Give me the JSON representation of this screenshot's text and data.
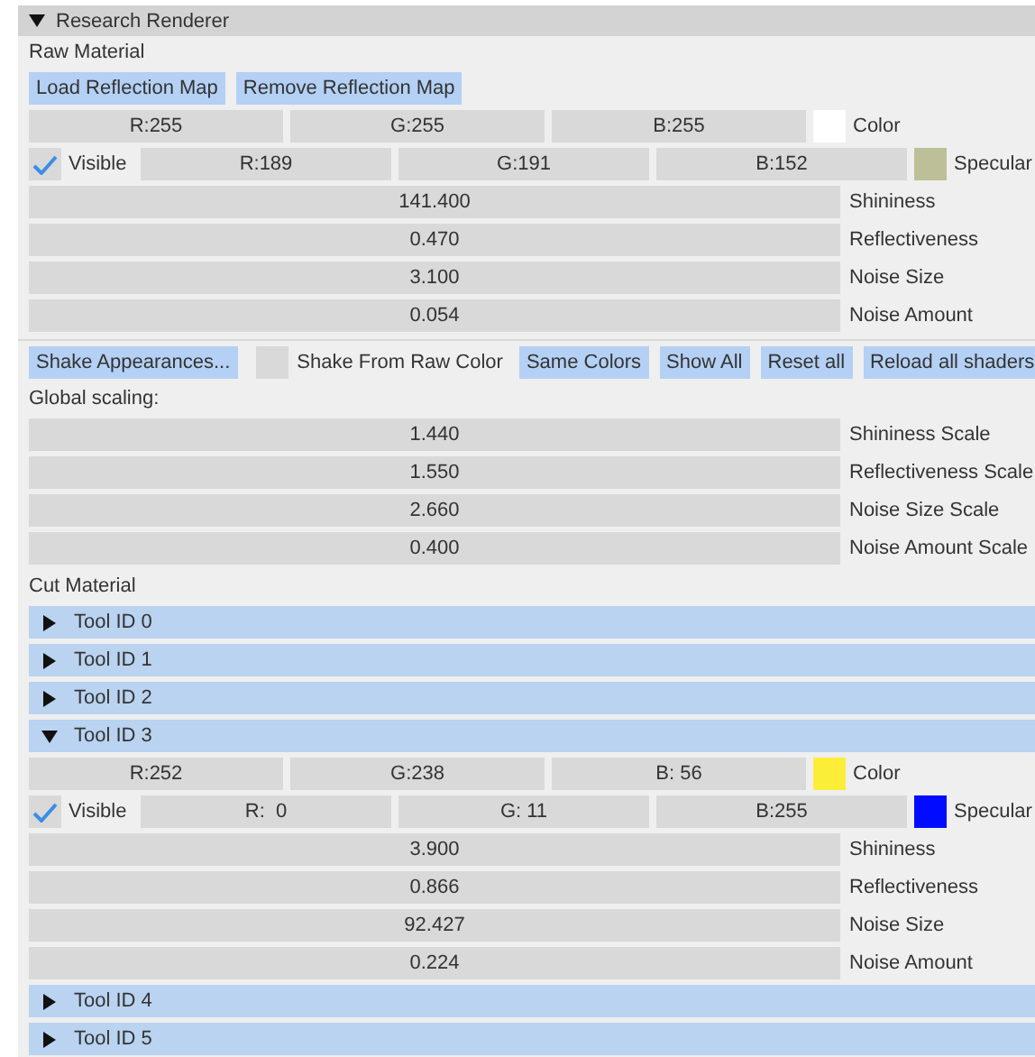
{
  "panel": {
    "title": "Research Renderer",
    "expanded": true
  },
  "raw_material": {
    "heading": "Raw Material",
    "buttons": [
      "Load Reflection Map",
      "Remove Reflection Map"
    ],
    "material": {
      "color": {
        "fields": [
          "R:255",
          "G:255",
          "B:255"
        ],
        "color": "#ffffff",
        "label": "Color"
      },
      "specular": {
        "visible": {
          "label": "Visible",
          "checked": true
        },
        "fields": [
          "R:189",
          "G:191",
          "B:152"
        ],
        "color": "#bdbf98",
        "label": "Specular"
      },
      "sliders": [
        {
          "value": "141.400",
          "label": "Shininess"
        },
        {
          "value": "0.470",
          "label": "Reflectiveness"
        },
        {
          "value": "3.100",
          "label": "Noise Size"
        },
        {
          "value": "0.054",
          "label": "Noise Amount"
        }
      ]
    }
  },
  "actions": [
    {
      "kind": "button",
      "label": "Shake Appearances..."
    },
    {
      "kind": "checkbox",
      "label": "Shake From Raw Color",
      "checked": false
    },
    {
      "kind": "button",
      "label": "Same Colors"
    },
    {
      "kind": "button",
      "label": "Show All"
    },
    {
      "kind": "button",
      "label": "Reset all"
    },
    {
      "kind": "button",
      "label": "Reload all shaders"
    }
  ],
  "global_scaling": {
    "heading": "Global scaling:",
    "sliders": [
      {
        "value": "1.440",
        "label": "Shininess Scale"
      },
      {
        "value": "1.550",
        "label": "Reflectiveness Scale"
      },
      {
        "value": "2.660",
        "label": "Noise Size Scale"
      },
      {
        "value": "0.400",
        "label": "Noise Amount Scale"
      }
    ]
  },
  "cut_material": {
    "heading": "Cut Material",
    "tools": [
      {
        "name": "Tool ID 0",
        "expanded": false
      },
      {
        "name": "Tool ID 1",
        "expanded": false
      },
      {
        "name": "Tool ID 2",
        "expanded": false
      },
      {
        "name": "Tool ID 3",
        "expanded": true,
        "material": {
          "color": {
            "fields": [
              "R:252",
              "G:238",
              "B: 56"
            ],
            "color": "#fcee38",
            "label": "Color"
          },
          "specular": {
            "visible": {
              "label": "Visible",
              "checked": true
            },
            "fields": [
              "R:  0",
              "G: 11",
              "B:255"
            ],
            "color": "#000bff",
            "label": "Specular"
          },
          "sliders": [
            {
              "value": "3.900",
              "label": "Shininess"
            },
            {
              "value": "0.866",
              "label": "Reflectiveness"
            },
            {
              "value": "92.427",
              "label": "Noise Size"
            },
            {
              "value": "0.224",
              "label": "Noise Amount"
            }
          ]
        }
      },
      {
        "name": "Tool ID 4",
        "expanded": false
      },
      {
        "name": "Tool ID 5",
        "expanded": false
      }
    ]
  }
}
